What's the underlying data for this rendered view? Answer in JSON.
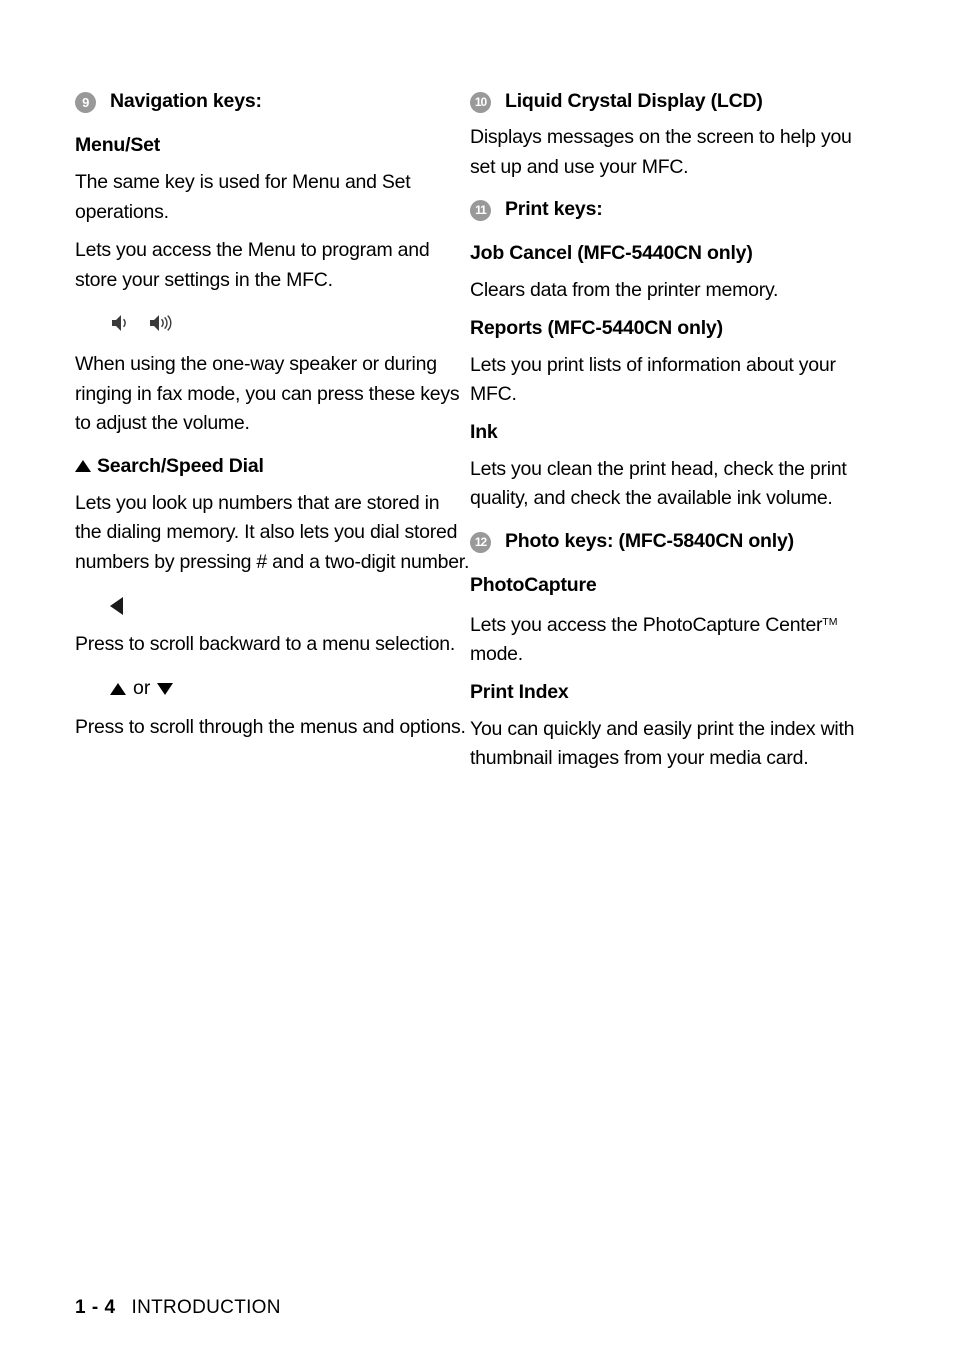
{
  "page": {
    "footer_page_number": "1 - 4",
    "footer_chapter": "INTRODUCTION",
    "badge_color": "#999999",
    "text_color": "#000000",
    "background_color": "#ffffff"
  },
  "left_column": {
    "item9": {
      "number": "9",
      "title": "Navigation keys:",
      "menu_set_heading": "Menu/Set",
      "menu_set_para1": "The same key is used for Menu and Set operations.",
      "menu_set_para2": "Lets you access the Menu to program and store your settings in the MFC.",
      "volume_icons": [
        "speaker-low-icon",
        "speaker-high-icon"
      ],
      "volume_para": "When using the one-way speaker or during ringing in fax mode, you can press these keys to adjust the volume.",
      "search_speed_dial_heading": "Search/Speed Dial",
      "search_speed_dial_para": "Lets you look up numbers that are stored in the dialing memory. It also lets you dial stored numbers by pressing # and a two-digit number.",
      "left_arrow_icon": "arrow-left-icon",
      "left_arrow_para": "Press to scroll backward to a menu selection.",
      "updown_label": "or",
      "up_arrow_icon": "arrow-up-icon",
      "down_arrow_icon": "arrow-down-icon",
      "updown_para": "Press to scroll through the menus and options."
    }
  },
  "right_column": {
    "item10": {
      "number": "10",
      "title": "Liquid Crystal Display (LCD)",
      "para": "Displays messages on the screen to help you set up and use your MFC."
    },
    "item11": {
      "number": "11",
      "title": "Print keys:",
      "job_cancel_heading": "Job Cancel (MFC-5440CN only)",
      "job_cancel_para": "Clears data from the printer memory.",
      "reports_heading": "Reports (MFC-5440CN only)",
      "reports_para": "Lets you print lists of information about your MFC.",
      "ink_heading": "Ink",
      "ink_para": "Lets you clean the print head, check the print quality, and check the available ink volume."
    },
    "item12": {
      "number": "12",
      "title": "Photo keys: (MFC-5840CN only)",
      "photocapture_heading": "PhotoCapture",
      "photocapture_para_before": "Lets you access the PhotoCapture Center",
      "photocapture_tm": "TM",
      "photocapture_para_after": " mode.",
      "print_index_heading": "Print Index",
      "print_index_para": "You can quickly and easily print the index with thumbnail images from your media card."
    }
  }
}
